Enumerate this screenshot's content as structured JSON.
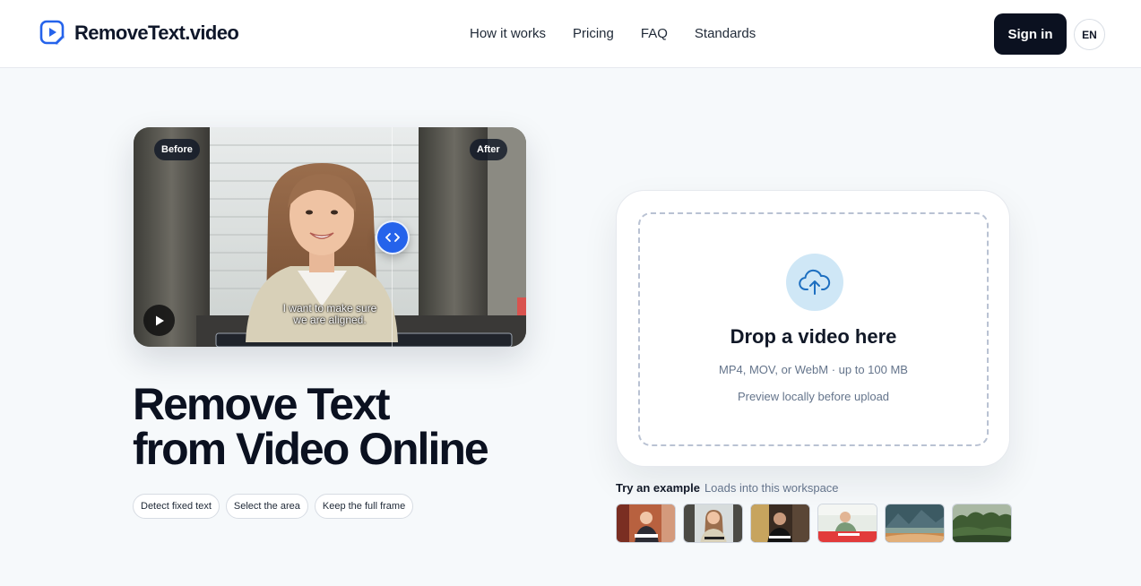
{
  "header": {
    "brand": "RemoveText.video",
    "logo_icon": "play-edit-icon",
    "nav": [
      {
        "label": "How it works"
      },
      {
        "label": "Pricing"
      },
      {
        "label": "FAQ"
      },
      {
        "label": "Standards"
      }
    ],
    "sign_in": "Sign in",
    "language": "EN"
  },
  "preview": {
    "before_label": "Before",
    "after_label": "After",
    "subtitle_line1": "I want to make sure",
    "subtitle_line2": "we are aligned.",
    "play_icon": "play-icon",
    "handle_icon": "compare-arrows-icon"
  },
  "hero": {
    "title_line1": "Remove Text",
    "title_line2": "from Video Online",
    "chips": [
      {
        "label": "Detect fixed text"
      },
      {
        "label": "Select the area"
      },
      {
        "label": "Keep the full frame"
      }
    ]
  },
  "upload": {
    "icon": "cloud-upload-icon",
    "title": "Drop a video here",
    "formats": "MP4, MOV, or WebM · up to 100 MB",
    "note": "Preview locally before upload"
  },
  "examples": {
    "label": "Try an example",
    "hint": "Loads into this workspace",
    "count": 6
  },
  "colors": {
    "accent": "#2563eb",
    "dark": "#0b1120",
    "background": "#f6f9fb",
    "upload_icon_bg": "#cfe7f6"
  }
}
